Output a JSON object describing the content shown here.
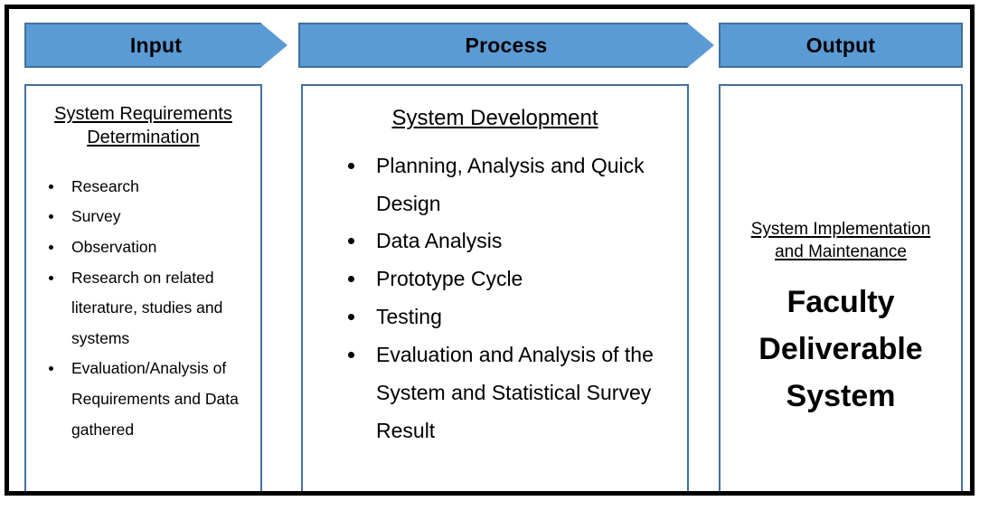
{
  "diagram": {
    "title": "Input Process Output Diagram",
    "colors": {
      "header_fill": "#5B9BD5",
      "header_border": "#41719C",
      "panel_border": "#41719C",
      "outer_frame": "#000000",
      "text": "#000000",
      "background": "#FFFFFF"
    }
  },
  "columns": {
    "input": {
      "header_label": "Input",
      "header_shape": "arrow-pentagon",
      "heading_lines": [
        "System Requirements ",
        "Determination"
      ],
      "bullets": [
        "Research",
        "Survey",
        "Observation",
        "Research on related literature, studies and systems",
        "Evaluation/Analysis of Requirements and Data gathered"
      ]
    },
    "process": {
      "header_label": "Process",
      "header_shape": "arrow-pentagon",
      "heading_lines": [
        "System Development"
      ],
      "bullets": [
        "Planning, Analysis and Quick Design",
        "Data Analysis",
        "Prototype Cycle",
        "Testing",
        "Evaluation and Analysis of the System and Statistical Survey Result"
      ]
    },
    "output": {
      "header_label": "Output",
      "header_shape": "rectangle",
      "heading_lines": [
        "System Implementation ",
        "and Maintenance"
      ],
      "emphasis_lines": [
        "Faculty",
        "Deliverable",
        "System"
      ]
    }
  }
}
